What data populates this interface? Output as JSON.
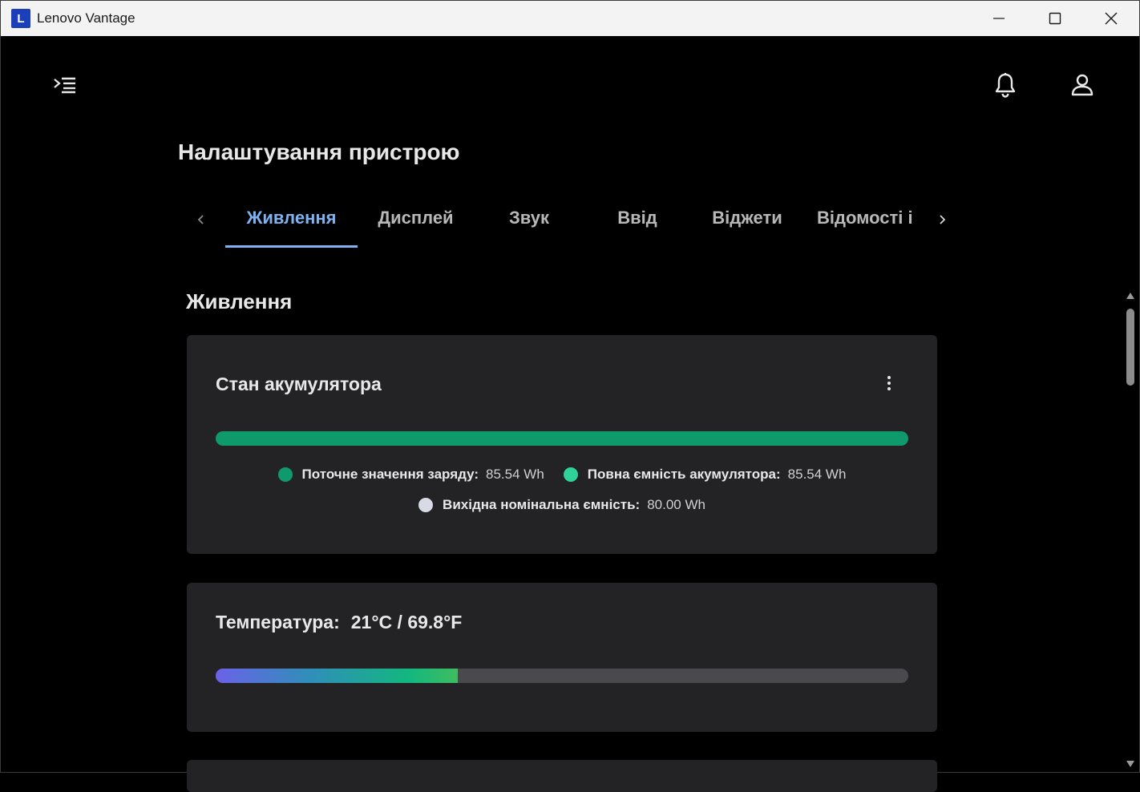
{
  "window": {
    "title": "Lenovo Vantage",
    "logo_letter": "L",
    "logo_color": "#1a3fb8"
  },
  "header": {
    "menu_icon": "menu-collapse-icon",
    "notifications_icon": "bell-icon",
    "account_icon": "person-icon"
  },
  "page": {
    "title": "Налаштування пристрою"
  },
  "tabs": {
    "items": [
      {
        "label": "Живлення",
        "active": true
      },
      {
        "label": "Дисплей",
        "active": false
      },
      {
        "label": "Звук",
        "active": false
      },
      {
        "label": "Ввід",
        "active": false
      },
      {
        "label": "Віджети",
        "active": false
      },
      {
        "label": "Відомості і",
        "active": false
      }
    ],
    "accent_color": "#7fb2f0"
  },
  "section": {
    "title": "Живлення"
  },
  "battery_card": {
    "title": "Стан акумулятора",
    "fill_fraction": 1.0,
    "bar_color": "#0f9a6c",
    "legend": [
      {
        "label": "Поточне значення заряду:",
        "value": "85.54 Wh",
        "color": "#0f9a6c"
      },
      {
        "label": "Повна ємність акумулятора:",
        "value": "85.54 Wh",
        "color": "#2fd39a"
      },
      {
        "label": "Вихідна номінальна ємність:",
        "value": "80.00 Wh",
        "color": "#d8dbe6"
      }
    ]
  },
  "temperature_card": {
    "label": "Температура:",
    "value": "21°C / 69.8°F",
    "fill_fraction": 0.35
  }
}
